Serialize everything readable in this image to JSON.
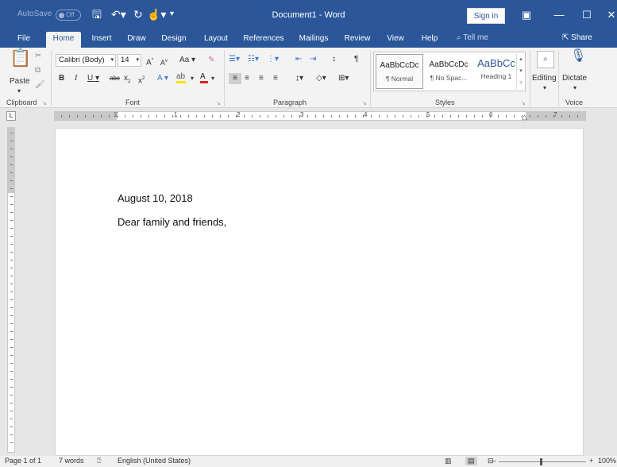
{
  "titlebar": {
    "autosave_label": "AutoSave",
    "autosave_state": "Off",
    "document_title": "Document1 - Word",
    "signin_label": "Sign in",
    "minimize": "—",
    "restore": "☐",
    "close": "✕",
    "ribbon_display_icon": "▣"
  },
  "tabs": [
    {
      "label": "File"
    },
    {
      "label": "Home"
    },
    {
      "label": "Insert"
    },
    {
      "label": "Draw"
    },
    {
      "label": "Design"
    },
    {
      "label": "Layout"
    },
    {
      "label": "References"
    },
    {
      "label": "Mailings"
    },
    {
      "label": "Review"
    },
    {
      "label": "View"
    },
    {
      "label": "Help"
    }
  ],
  "tell_me": "Tell me",
  "share_label": "Share",
  "ribbon": {
    "clipboard": {
      "paste_label": "Paste",
      "group_label": "Clipboard"
    },
    "font": {
      "font_name": "Calibri (Body)",
      "font_size": "14",
      "group_label": "Font",
      "case_label": "Aa"
    },
    "paragraph": {
      "group_label": "Paragraph"
    },
    "styles": {
      "group_label": "Styles",
      "items": [
        {
          "preview": "AaBbCcDc",
          "name": "¶ Normal"
        },
        {
          "preview": "AaBbCcDc",
          "name": "¶ No Spac..."
        },
        {
          "preview": "AaBbCc",
          "name": "Heading 1"
        }
      ]
    },
    "editing": {
      "label": "Editing"
    },
    "voice": {
      "dictate_label": "Dictate",
      "group_label": "Voice"
    }
  },
  "ruler_numbers": [
    "1",
    "2",
    "3",
    "4",
    "5",
    "6",
    "7"
  ],
  "document": {
    "lines": [
      "August 10, 2018",
      "Dear family and friends,"
    ]
  },
  "status": {
    "page": "Page 1 of 1",
    "words": "7 words",
    "language": "English (United States)",
    "zoom_minus": "–",
    "zoom_plus": "+",
    "zoom": "100%"
  }
}
